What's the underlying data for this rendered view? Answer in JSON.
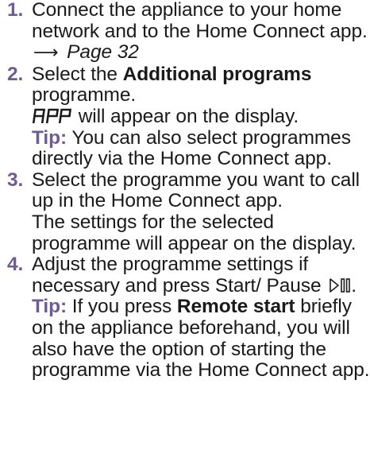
{
  "steps": [
    {
      "number": "1.",
      "text_a": "Connect the appliance to your home network and to the Home Connect app.",
      "arrow": "⟶",
      "page_ref": "Page 32"
    },
    {
      "number": "2.",
      "text_a": "Select the ",
      "bold": "Additional programs",
      "text_b": " programme.",
      "display_code": "APP",
      "display_text": " will appear on the display.",
      "tip_label": "Tip:",
      "tip_text": " You can also select programmes directly via the Home Connect app."
    },
    {
      "number": "3.",
      "text_a": "Select the programme you want to call up in the Home Connect app.",
      "text_b": "The settings for the selected programme will appear on the display."
    },
    {
      "number": "4.",
      "text_a": "Adjust the programme settings if necessary and press Start/ Pause ",
      "icon": "start-pause-icon",
      "text_b": ".",
      "tip_label": "Tip:",
      "tip_text_a": " If you press ",
      "tip_bold": "Remote start",
      "tip_text_b": " briefly on the appliance beforehand, you will also have the option of starting the programme via the Home Connect app."
    }
  ],
  "colors": {
    "accent": "#6f5a96",
    "text": "#1a1a1a"
  }
}
